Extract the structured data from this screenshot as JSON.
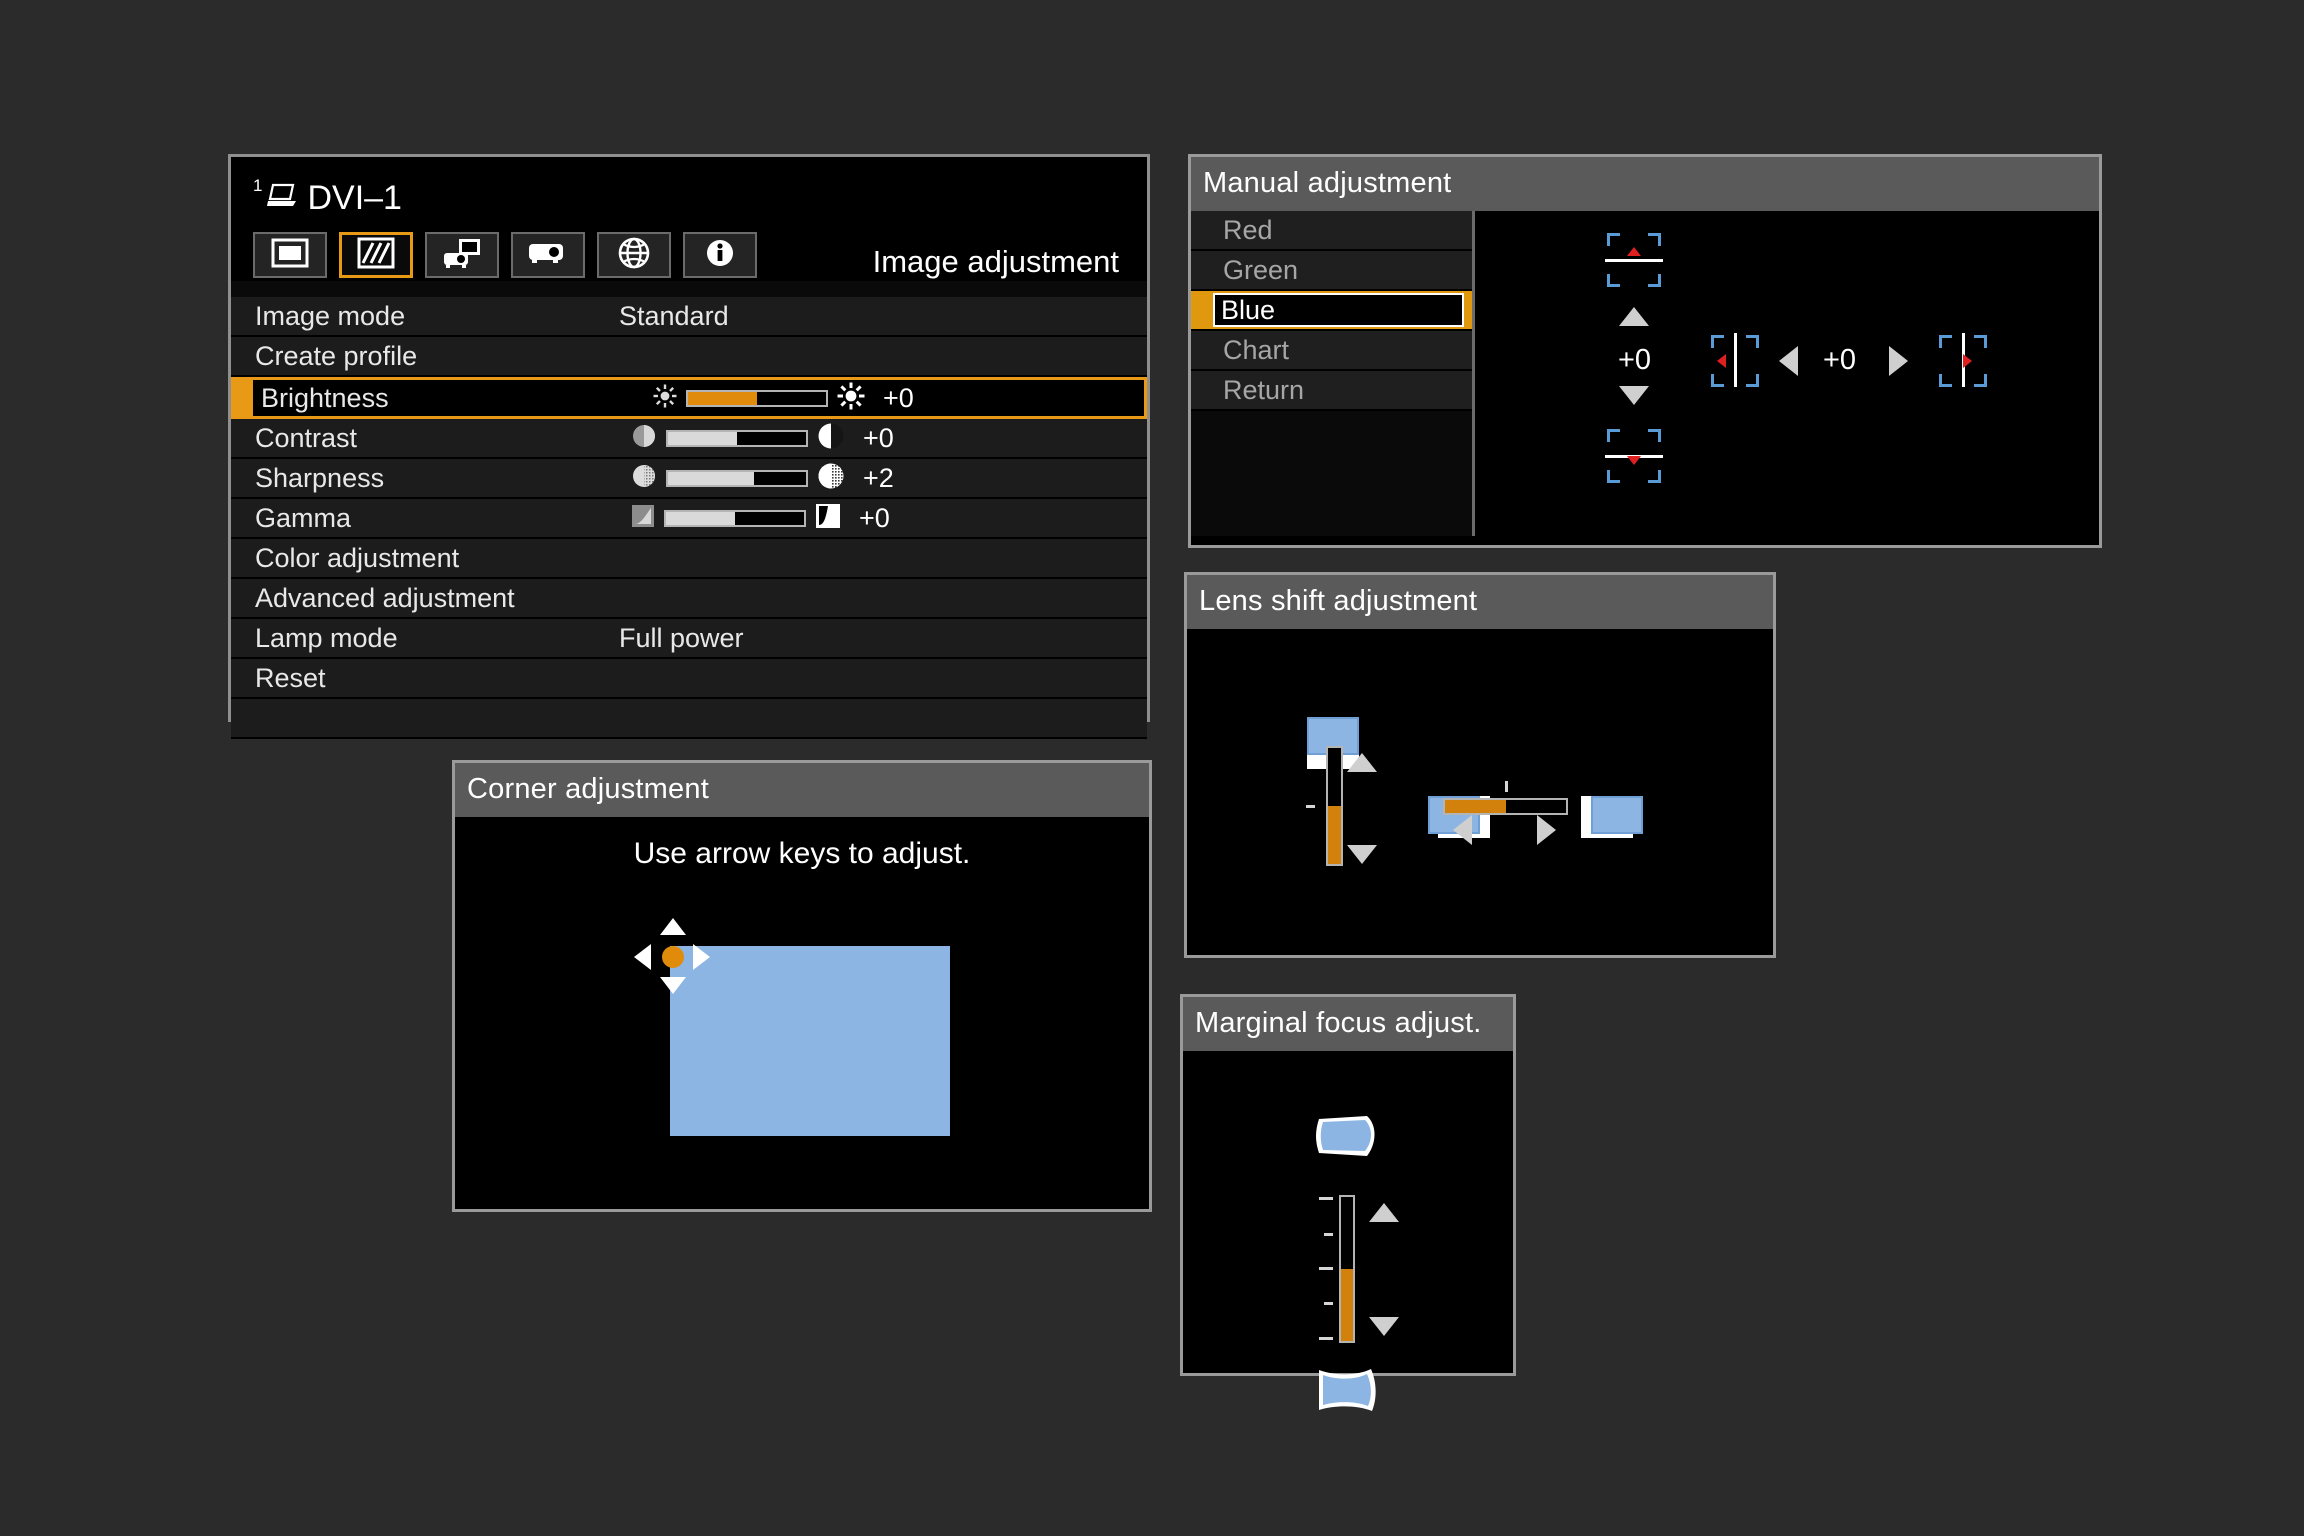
{
  "theme": {
    "background": "#2b2b2b",
    "accent_orange": "#e89a16",
    "panel_title_bg": "#5a5a5a",
    "row_bg": "#1c1c1c",
    "screen_blue": "#8cb5e3",
    "bracket_blue": "#5b9bd5",
    "marker_red": "#e02020"
  },
  "main_menu": {
    "source_superscript": "1",
    "source_label": "DVI–1",
    "source_icon": "laptop-icon",
    "section_title": "Image adjustment",
    "tabs": [
      {
        "icon": "screen-icon",
        "active": false
      },
      {
        "icon": "image-adjust-icon",
        "active": true
      },
      {
        "icon": "install-icon",
        "active": false
      },
      {
        "icon": "projector-icon",
        "active": false
      },
      {
        "icon": "network-icon",
        "active": false
      },
      {
        "icon": "info-icon",
        "active": false
      }
    ],
    "rows": [
      {
        "label": "Image mode",
        "value": "Standard",
        "type": "value",
        "selected": false
      },
      {
        "label": "Create profile",
        "value": "",
        "type": "plain",
        "selected": false
      },
      {
        "label": "Brightness",
        "type": "slider",
        "icon_left": "brightness-low-icon",
        "icon_right": "brightness-high-icon",
        "fill_pct": 50,
        "fill_orange": true,
        "number": "+0",
        "selected": true
      },
      {
        "label": "Contrast",
        "type": "slider",
        "icon_left": "contrast-low-icon",
        "icon_right": "contrast-high-icon",
        "fill_pct": 50,
        "fill_orange": false,
        "number": "+0",
        "selected": false
      },
      {
        "label": "Sharpness",
        "type": "slider",
        "icon_left": "sharpness-low-icon",
        "icon_right": "sharpness-high-icon",
        "fill_pct": 62,
        "fill_orange": false,
        "number": "+2",
        "selected": false
      },
      {
        "label": "Gamma",
        "type": "slider",
        "icon_left": "gamma-low-icon",
        "icon_right": "gamma-high-icon",
        "fill_pct": 50,
        "fill_orange": false,
        "number": "+0",
        "selected": false
      },
      {
        "label": "Color adjustment",
        "value": "",
        "type": "plain",
        "selected": false
      },
      {
        "label": "Advanced adjustment",
        "value": "",
        "type": "plain",
        "selected": false
      },
      {
        "label": "Lamp mode",
        "value": "Full power",
        "type": "value",
        "selected": false
      },
      {
        "label": "Reset",
        "value": "",
        "type": "plain",
        "selected": false
      },
      {
        "label": "",
        "value": "",
        "type": "blank",
        "selected": false
      }
    ]
  },
  "corner_adjustment": {
    "title": "Corner adjustment",
    "hint": "Use arrow keys to adjust."
  },
  "manual_adjustment": {
    "title": "Manual adjustment",
    "items": [
      {
        "label": "Red",
        "selected": false
      },
      {
        "label": "Green",
        "selected": false
      },
      {
        "label": "Blue",
        "selected": true
      },
      {
        "label": "Chart",
        "selected": false
      },
      {
        "label": "Return",
        "selected": false
      }
    ],
    "vertical_value": "+0",
    "horizontal_value": "+0"
  },
  "lens_shift": {
    "title": "Lens shift adjustment",
    "vertical_fill_pct": 50,
    "horizontal_fill_pct": 50
  },
  "marginal_focus": {
    "title": "Marginal focus adjust.",
    "fill_pct": 50
  }
}
